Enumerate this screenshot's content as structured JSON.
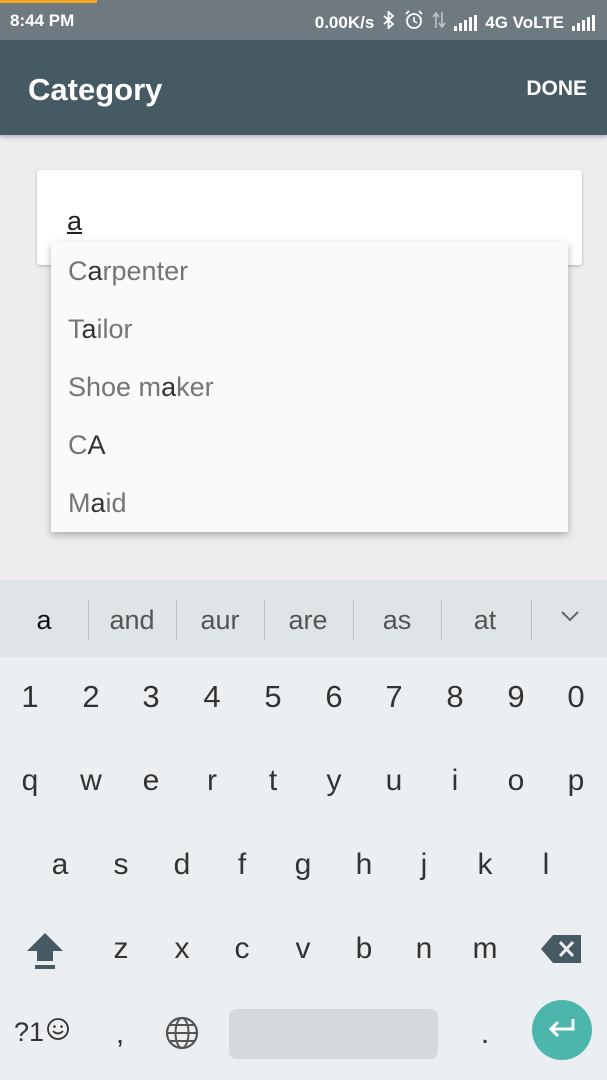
{
  "status_bar": {
    "time": "8:44 PM",
    "net_speed": "0.00K/s",
    "network": "4G VoLTE",
    "icons": [
      "bluetooth-icon",
      "alarm-icon",
      "data-arrows-icon",
      "signal-icon",
      "signal-icon"
    ]
  },
  "app_bar": {
    "title": "Category",
    "done_label": "DONE",
    "color": "#455a63"
  },
  "input": {
    "value": "a"
  },
  "suggestions": [
    {
      "pre": "C",
      "hl": "a",
      "post": "rpenter"
    },
    {
      "pre": "T",
      "hl": "a",
      "post": "ilor"
    },
    {
      "pre": "Shoe m",
      "hl": "a",
      "post": "ker"
    },
    {
      "pre": "C",
      "hl": "A",
      "post": ""
    },
    {
      "pre": "M",
      "hl": "a",
      "post": "id"
    }
  ],
  "keyboard": {
    "suggestion_words": [
      "a",
      "and",
      "aur",
      "are",
      "as",
      "at"
    ],
    "number_row": [
      "1",
      "2",
      "3",
      "4",
      "5",
      "6",
      "7",
      "8",
      "9",
      "0"
    ],
    "row1": [
      "q",
      "w",
      "e",
      "r",
      "t",
      "y",
      "u",
      "i",
      "o",
      "p"
    ],
    "row2": [
      "a",
      "s",
      "d",
      "f",
      "g",
      "h",
      "j",
      "k",
      "l"
    ],
    "row3": [
      "z",
      "x",
      "c",
      "v",
      "b",
      "n",
      "m"
    ],
    "symbols_label": "?1",
    "comma": ",",
    "period": ".",
    "accent_color": "#4db6ac"
  }
}
